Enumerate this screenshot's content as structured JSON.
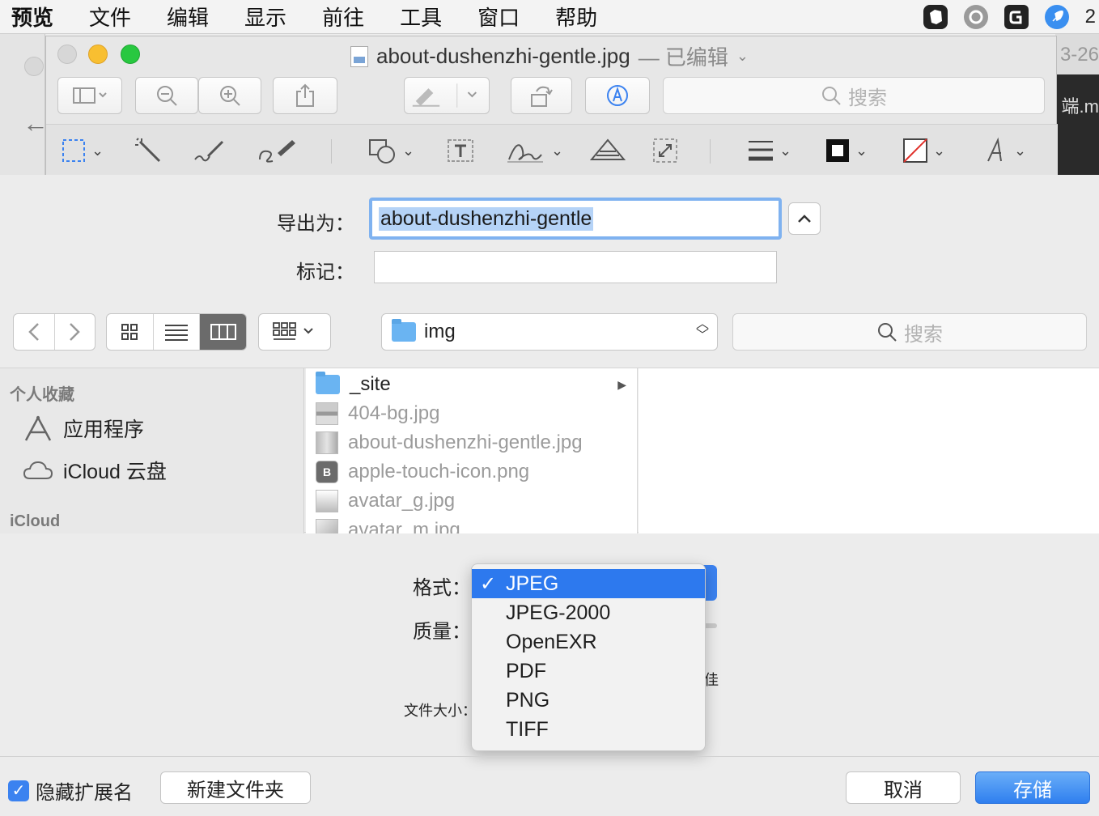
{
  "menubar": {
    "app": "预览",
    "items": [
      "文件",
      "编辑",
      "显示",
      "前往",
      "工具",
      "窗口",
      "帮助"
    ],
    "status_icons": [
      "evernote-icon",
      "grammarly-icon",
      "g-icon",
      "rocket-icon"
    ],
    "status_tail": "2"
  },
  "background": {
    "date_fragment": "3-26",
    "dark_fragment": "端.m"
  },
  "window": {
    "title": "about-dushenzhi-gentle.jpg",
    "edited": "— 已编辑",
    "search_placeholder": "搜索"
  },
  "export": {
    "export_as_label": "导出为：",
    "filename": "about-dushenzhi-gentle",
    "tags_label": "标记：",
    "tags_value": "",
    "location": "img",
    "search_placeholder": "搜索"
  },
  "sidebar": {
    "favorites_title": "个人收藏",
    "items": [
      {
        "label": "应用程序",
        "icon": "applications-icon"
      },
      {
        "label": "iCloud 云盘",
        "icon": "icloud-icon"
      }
    ],
    "icloud_title": "iCloud"
  },
  "files": [
    {
      "name": "_site",
      "type": "folder"
    },
    {
      "name": "404-bg.jpg",
      "type": "image"
    },
    {
      "name": "about-dushenzhi-gentle.jpg",
      "type": "image"
    },
    {
      "name": "apple-touch-icon.png",
      "type": "image"
    },
    {
      "name": "avatar_g.jpg",
      "type": "image"
    },
    {
      "name": "avatar_m.jpg",
      "type": "image"
    }
  ],
  "options": {
    "format_label": "格式：",
    "quality_label": "质量：",
    "quality_best": "佳",
    "filesize_label": "文件大小：",
    "formats": [
      "JPEG",
      "JPEG-2000",
      "OpenEXR",
      "PDF",
      "PNG",
      "TIFF"
    ],
    "selected_format": "JPEG"
  },
  "bottom": {
    "hide_extension": "隐藏扩展名",
    "hide_extension_checked": true,
    "new_folder": "新建文件夹",
    "cancel": "取消",
    "save": "存储"
  },
  "colors": {
    "accent": "#2d79ee",
    "traffic_min": "#f8bf31",
    "traffic_zoom": "#28c840"
  }
}
